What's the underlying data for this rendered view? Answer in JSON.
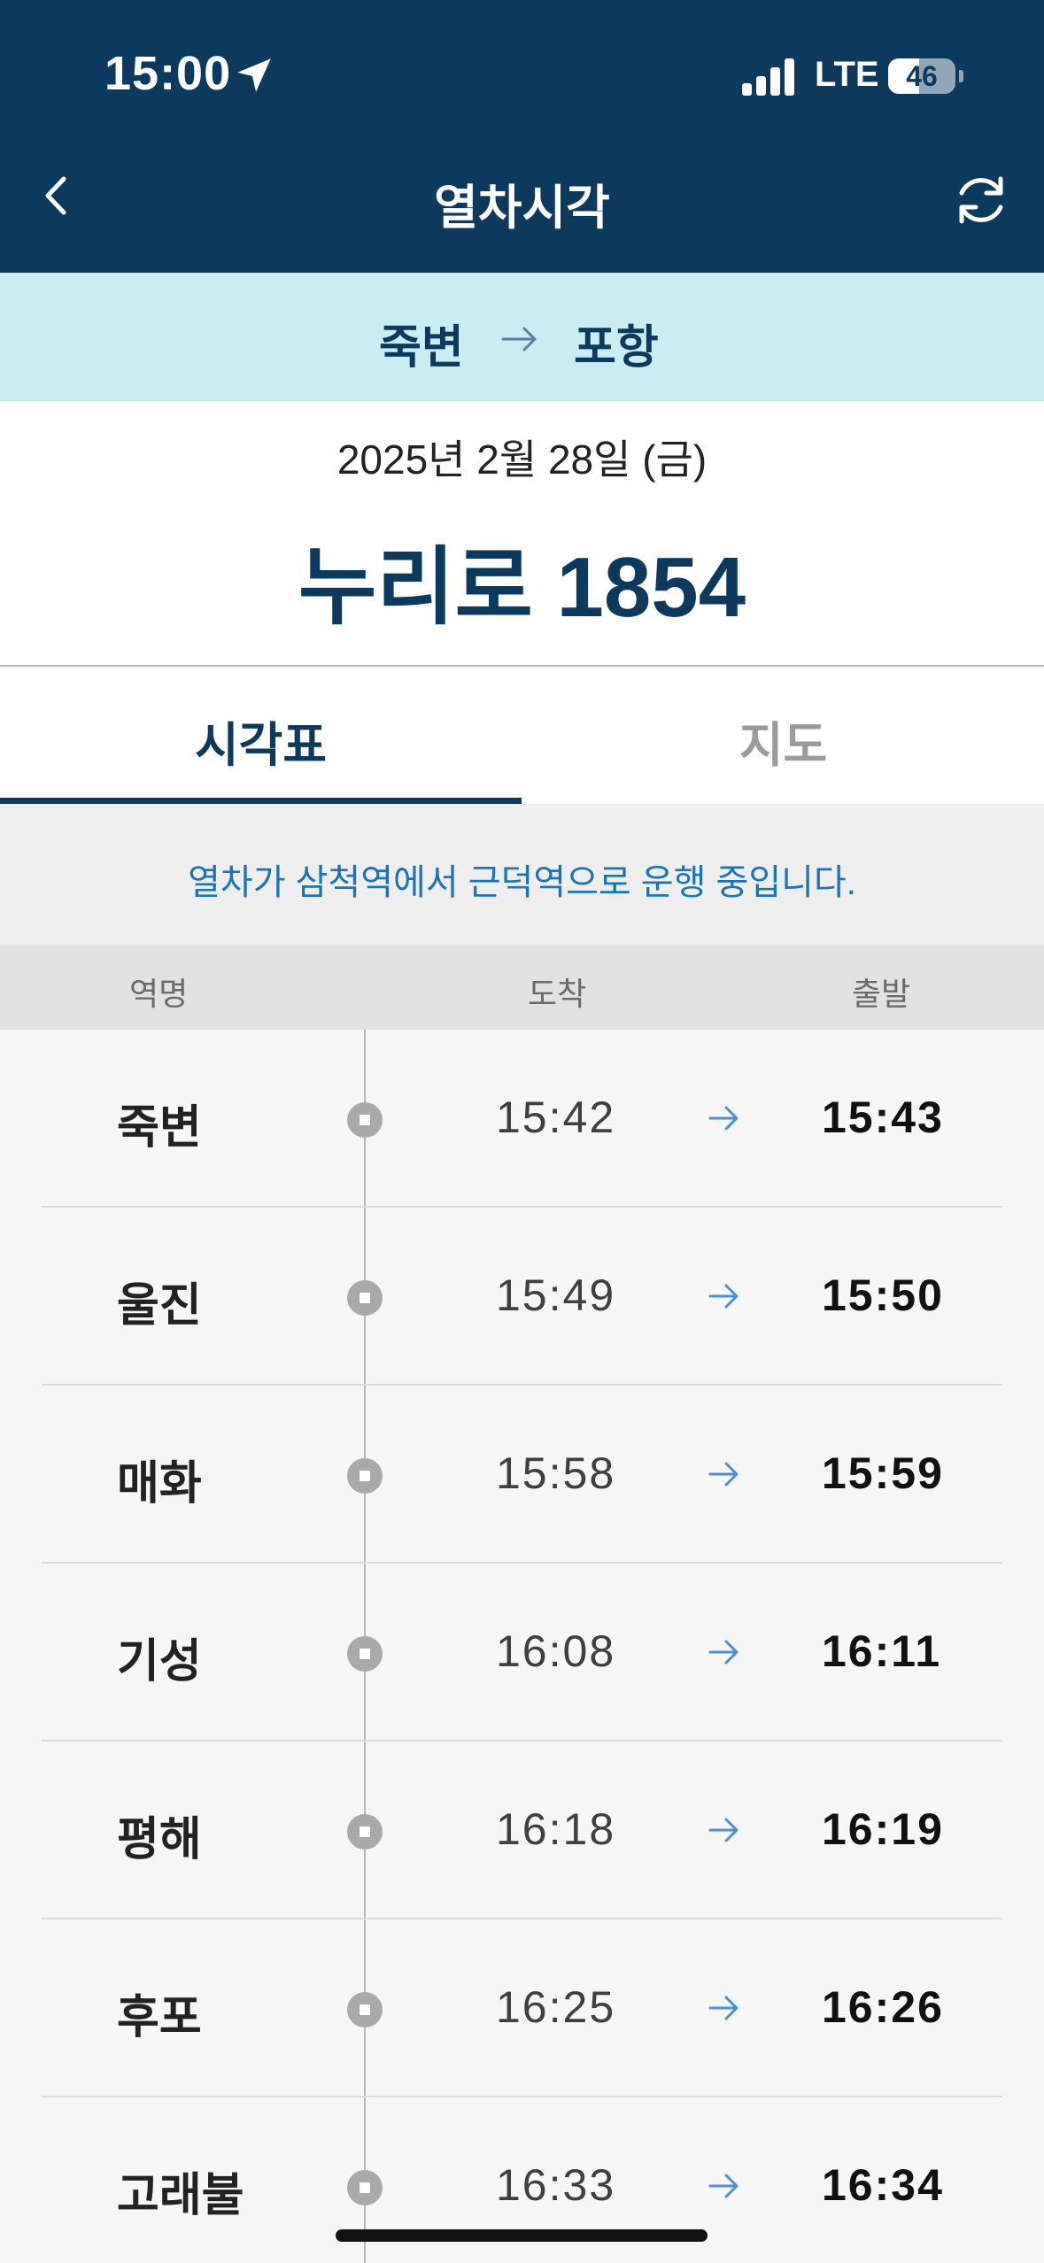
{
  "status_bar": {
    "time": "15:00",
    "network": "LTE",
    "battery": "46",
    "battery_level": 0.46
  },
  "header": {
    "title": "열차시각"
  },
  "route": {
    "from": "죽변",
    "to": "포항"
  },
  "train_info": {
    "date": "2025년 2월 28일 (금)",
    "train_name": "누리로 1854"
  },
  "tabs": [
    {
      "label": "시각표",
      "active": true
    },
    {
      "label": "지도",
      "active": false
    }
  ],
  "notice": "열차가 삼척역에서 근덕역으로 운행 중입니다.",
  "columns": {
    "station": "역명",
    "arrive": "도착",
    "depart": "출발"
  },
  "stops": [
    {
      "station": "죽변",
      "arrive": "15:42",
      "depart": "15:43"
    },
    {
      "station": "울진",
      "arrive": "15:49",
      "depart": "15:50"
    },
    {
      "station": "매화",
      "arrive": "15:58",
      "depart": "15:59"
    },
    {
      "station": "기성",
      "arrive": "16:08",
      "depart": "16:11"
    },
    {
      "station": "평해",
      "arrive": "16:18",
      "depart": "16:19"
    },
    {
      "station": "후포",
      "arrive": "16:25",
      "depart": "16:26"
    },
    {
      "station": "고래불",
      "arrive": "16:33",
      "depart": "16:34"
    }
  ],
  "colors": {
    "primary": "#0c3a5f",
    "route_bg": "#c8eef4",
    "notice_text": "#1a74b8",
    "arrow": "#4a90d0"
  }
}
